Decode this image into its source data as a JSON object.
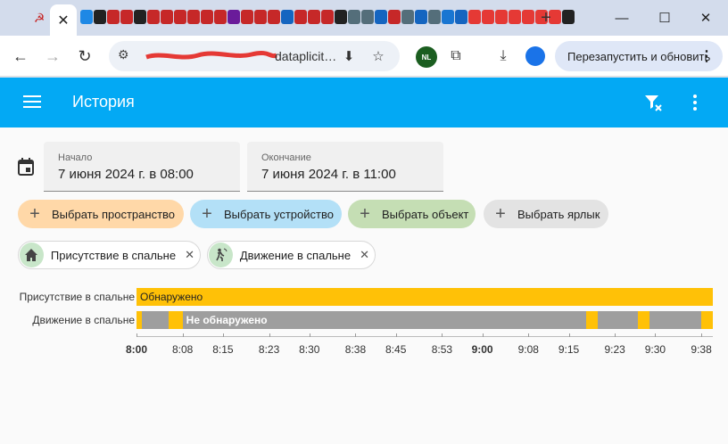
{
  "browser": {
    "tab_close": "✕",
    "new_tab": "+",
    "favicon_colors": [
      "#1e88e5",
      "#222",
      "#c62828",
      "#c62828",
      "#222",
      "#c62828",
      "#c62828",
      "#c62828",
      "#c62828",
      "#c62828",
      "#c62828",
      "#6a1b9a",
      "#c62828",
      "#c62828",
      "#c62828",
      "#1565c0",
      "#c62828",
      "#c62828",
      "#c62828",
      "#222",
      "#546e7a",
      "#546e7a",
      "#1565c0",
      "#c62828",
      "#546e7a",
      "#1565c0",
      "#546e7a",
      "#1976d2",
      "#1565c0",
      "#e53935",
      "#e53935",
      "#e53935",
      "#e53935",
      "#e53935",
      "#e53935",
      "#e53935",
      "#222"
    ],
    "url": "dataplicit…",
    "update_button": "Перезапустить и обновить",
    "nl_extension": "NL"
  },
  "app": {
    "title": "История",
    "start": {
      "label": "Начало",
      "value": "7 июня 2024 г. в 08:00"
    },
    "end": {
      "label": "Окончание",
      "value": "7 июня 2024 г. в 11:00"
    },
    "pickers": [
      {
        "label": "Выбрать пространство",
        "color": "#ffd8a8"
      },
      {
        "label": "Выбрать устройство",
        "color": "#b3e0f7"
      },
      {
        "label": "Выбрать объект",
        "color": "#c5deb4"
      },
      {
        "label": "Выбрать ярлык",
        "color": "#e3e3e3"
      }
    ],
    "chips": [
      {
        "label": "Присутствие в спальне",
        "icon": "home-icon"
      },
      {
        "label": "Движение в спальне",
        "icon": "motion-sensor-icon"
      }
    ]
  },
  "chart_data": {
    "type": "timeline",
    "x_range": [
      "8:00",
      "9:40"
    ],
    "x_ticks": [
      "8:00",
      "8:08",
      "8:15",
      "8:23",
      "8:30",
      "8:38",
      "8:45",
      "8:53",
      "9:00",
      "9:08",
      "9:15",
      "9:23",
      "9:30",
      "9:38"
    ],
    "rows": [
      {
        "label": "Присутствие в спальне",
        "segments": [
          {
            "start": "8:00",
            "end": "9:40",
            "state": "Обнаружено",
            "color": "#ffc107"
          }
        ]
      },
      {
        "label": "Движение в спальне",
        "segments": [
          {
            "start": "8:00",
            "end": "8:01",
            "state": "Обнаружено",
            "color": "#ffc107"
          },
          {
            "start": "8:01",
            "end": "8:05.5",
            "state": "Не обнаружено",
            "color": "#9e9e9e"
          },
          {
            "start": "8:05.5",
            "end": "8:08",
            "state": "Обнаружено",
            "color": "#ffc107"
          },
          {
            "start": "8:08",
            "end": "9:18",
            "state": "Не обнаружено",
            "color": "#9e9e9e",
            "show_label": true
          },
          {
            "start": "9:18",
            "end": "9:20",
            "state": "Обнаружено",
            "color": "#ffc107"
          },
          {
            "start": "9:20",
            "end": "9:27",
            "state": "Не обнаружено",
            "color": "#9e9e9e"
          },
          {
            "start": "9:27",
            "end": "9:29",
            "state": "Обнаружено",
            "color": "#ffc107"
          },
          {
            "start": "9:29",
            "end": "9:38",
            "state": "Не обнаружено",
            "color": "#9e9e9e"
          },
          {
            "start": "9:38",
            "end": "9:40",
            "state": "Обнаружено",
            "color": "#ffc107"
          }
        ]
      }
    ]
  }
}
